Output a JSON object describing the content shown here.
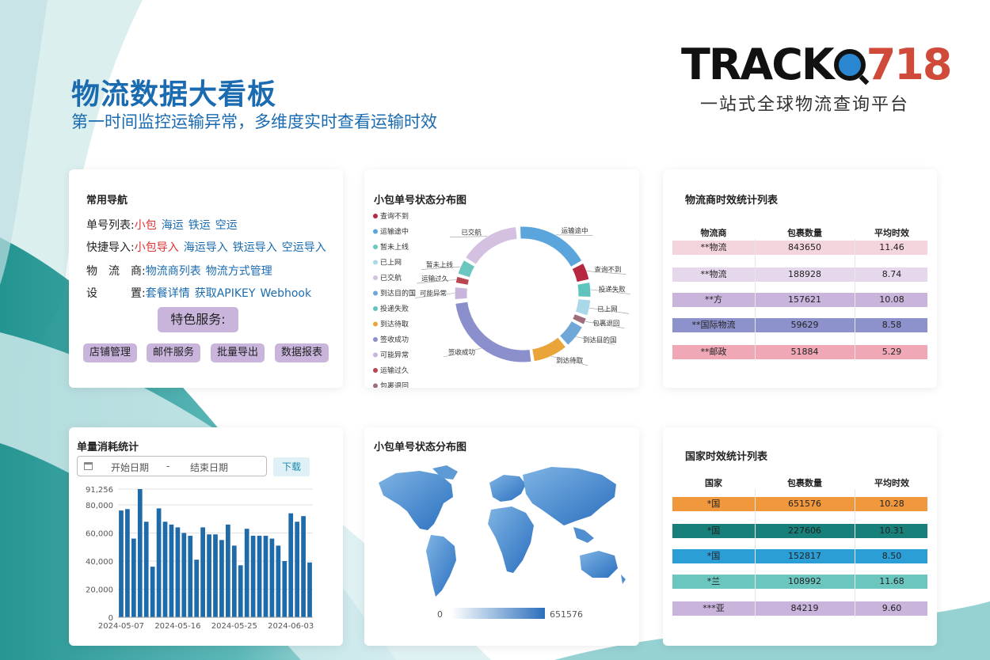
{
  "header": {
    "title": "物流数据大看板",
    "subtitle": "第一时间监控运输异常，多维度实时查看运输时效"
  },
  "logo": {
    "brand_black": "TRACK",
    "brand_red": "718",
    "slogan": "一站式全球物流查询平台",
    "icon": "globe-search-icon"
  },
  "nav": {
    "title": "常用导航",
    "rows": [
      {
        "label": "单号列表:",
        "items": [
          {
            "text": "小包",
            "color": "red"
          },
          {
            "text": "海运",
            "color": "blue"
          },
          {
            "text": "铁运",
            "color": "blue"
          },
          {
            "text": "空运",
            "color": "blue"
          }
        ]
      },
      {
        "label": "快捷导入:",
        "items": [
          {
            "text": "小包导入",
            "color": "red"
          },
          {
            "text": "海运导入",
            "color": "blue"
          },
          {
            "text": "铁运导入",
            "color": "blue"
          },
          {
            "text": "空运导入",
            "color": "blue"
          }
        ]
      },
      {
        "label": "物　流　商:",
        "items": [
          {
            "text": "物流商列表",
            "color": "blue"
          },
          {
            "text": "物流方式管理",
            "color": "blue"
          }
        ]
      },
      {
        "label": "设　　　置:",
        "items": [
          {
            "text": "套餐详情",
            "color": "blue"
          },
          {
            "text": "获取APIKEY",
            "color": "blue"
          },
          {
            "text": "Webhook",
            "color": "blue"
          }
        ]
      }
    ],
    "special_label": "特色服务:",
    "services": [
      "店铺管理",
      "邮件服务",
      "批量导出",
      "数据报表"
    ]
  },
  "status_chart": {
    "title": "小包单号状态分布图",
    "legend": [
      "查询不到",
      "运输途中",
      "暂未上线",
      "已上网",
      "已交航",
      "到达目的国",
      "投递失败",
      "到达待取",
      "签收成功",
      "可能异常",
      "运输过久",
      "包裹退回"
    ],
    "colors": {
      "查询不到": "#b5283f",
      "运输途中": "#5aa6dc",
      "暂未上线": "#6cc6c0",
      "已上网": "#a9d8e8",
      "已交航": "#d4c0e0",
      "到达目的国": "#6fa8d8",
      "投递失败": "#5fc4bd",
      "到达待取": "#e9a53a",
      "签收成功": "#8b8fcc",
      "可能异常": "#c9b4dc",
      "运输过久": "#b8454f",
      "包裹退回": "#9e6c7a"
    },
    "slice_labels": [
      "运输途中",
      "查询不到",
      "投递失败",
      "已上网",
      "包裹退回",
      "到达目的国",
      "到达待取",
      "签收成功",
      "可能异常",
      "运输过久",
      "暂未上线",
      "已交航"
    ]
  },
  "carrier_table": {
    "title": "物流商时效统计列表",
    "columns": [
      "物流商",
      "包裹数量",
      "平均时效"
    ],
    "rows": [
      {
        "name": "**物流",
        "count": "843650",
        "avg": "11.46",
        "color": "#f5d5dc"
      },
      {
        "name": "**物流",
        "count": "188928",
        "avg": "8.74",
        "color": "#e6d8ec"
      },
      {
        "name": "**方",
        "count": "157621",
        "avg": "10.08",
        "color": "#c9b4dc"
      },
      {
        "name": "**国际物流",
        "count": "59629",
        "avg": "8.58",
        "color": "#8e92cc"
      },
      {
        "name": "**邮政",
        "count": "51884",
        "avg": "5.29",
        "color": "#f0a8b6"
      }
    ]
  },
  "usage_chart": {
    "title": "单量消耗统计",
    "start_placeholder": "开始日期",
    "separator": "-",
    "end_placeholder": "结束日期",
    "download_label": "下载",
    "calendar_icon": "calendar-icon"
  },
  "chart_data": {
    "type": "bar",
    "x_ticks": [
      "2024-05-07",
      "2024-05-16",
      "2024-05-25",
      "2024-06-03"
    ],
    "y_ticks": [
      "0",
      "20,000",
      "40,000",
      "60,000",
      "80,000",
      "91,256"
    ],
    "ylim": [
      0,
      91256
    ],
    "grid": true,
    "color": "#1f6aa8",
    "values": [
      76000,
      77000,
      56000,
      91256,
      68000,
      36000,
      77500,
      68000,
      66000,
      64000,
      60000,
      58000,
      41000,
      64000,
      59000,
      59000,
      55000,
      66000,
      51000,
      37000,
      63000,
      58000,
      58000,
      58000,
      56000,
      51000,
      40000,
      74000,
      68000,
      72000,
      39000
    ]
  },
  "map_card": {
    "title": "小包单号状态分布图",
    "legend_min": "0",
    "legend_max": "651576"
  },
  "country_table": {
    "title": "国家时效统计列表",
    "columns": [
      "国家",
      "包裹数量",
      "平均时效"
    ],
    "rows": [
      {
        "name": "*国",
        "count": "651576",
        "avg": "10.28",
        "color": "#f1973c"
      },
      {
        "name": "*国",
        "count": "227606",
        "avg": "10.31",
        "color": "#17807a"
      },
      {
        "name": "*国",
        "count": "152817",
        "avg": "8.50",
        "color": "#2b9ed6"
      },
      {
        "name": "*兰",
        "count": "108992",
        "avg": "11.68",
        "color": "#6cc6c0"
      },
      {
        "name": "***亚",
        "count": "84219",
        "avg": "9.60",
        "color": "#c9b4dc"
      }
    ]
  }
}
